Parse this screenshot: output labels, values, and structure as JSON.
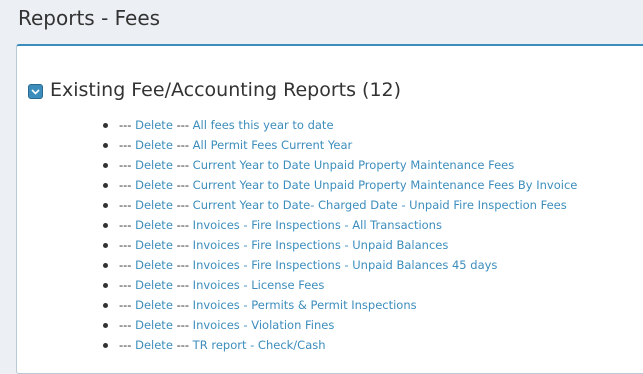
{
  "page": {
    "title": "Reports - Fees"
  },
  "section": {
    "title": "Existing Fee/Accounting Reports (12)",
    "toggle_icon": "chevron-down-icon"
  },
  "colors": {
    "link": "#3c8dbc",
    "accent": "#3c8dbc",
    "background": "#ecf0f5"
  },
  "reports": [
    {
      "prefix": "---",
      "delete_label": "Delete",
      "separator": "---",
      "name": "All fees this year to date"
    },
    {
      "prefix": "---",
      "delete_label": "Delete",
      "separator": "---",
      "name": "All Permit Fees Current Year"
    },
    {
      "prefix": "---",
      "delete_label": "Delete",
      "separator": "---",
      "name": "Current Year to Date Unpaid Property Maintenance Fees"
    },
    {
      "prefix": "---",
      "delete_label": "Delete",
      "separator": "---",
      "name": "Current Year to Date Unpaid Property Maintenance Fees By Invoice"
    },
    {
      "prefix": "---",
      "delete_label": "Delete",
      "separator": "---",
      "name": "Current Year to Date- Charged Date - Unpaid Fire Inspection Fees"
    },
    {
      "prefix": "---",
      "delete_label": "Delete",
      "separator": "---",
      "name": "Invoices - Fire Inspections - All Transactions"
    },
    {
      "prefix": "---",
      "delete_label": "Delete",
      "separator": "---",
      "name": "Invoices - Fire Inspections - Unpaid Balances"
    },
    {
      "prefix": "---",
      "delete_label": "Delete",
      "separator": "---",
      "name": "Invoices - Fire Inspections - Unpaid Balances 45 days"
    },
    {
      "prefix": "---",
      "delete_label": "Delete",
      "separator": "---",
      "name": "Invoices - License Fees"
    },
    {
      "prefix": "---",
      "delete_label": "Delete",
      "separator": "---",
      "name": "Invoices - Permits & Permit Inspections"
    },
    {
      "prefix": "---",
      "delete_label": "Delete",
      "separator": "---",
      "name": "Invoices - Violation Fines"
    },
    {
      "prefix": "---",
      "delete_label": "Delete",
      "separator": "---",
      "name": "TR report - Check/Cash"
    }
  ]
}
